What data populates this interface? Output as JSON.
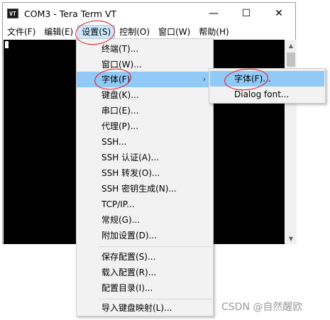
{
  "window": {
    "title": "COM3 - Tera Term VT",
    "icon_text": "VT",
    "controls": {
      "minimize": "—",
      "maximize": "☐",
      "close": "✕"
    }
  },
  "menubar": {
    "items": [
      {
        "label": "文件(F)"
      },
      {
        "label": "编辑(E)"
      },
      {
        "label": "设置(S)",
        "active": true
      },
      {
        "label": "控制(O)"
      },
      {
        "label": "窗口(W)"
      },
      {
        "label": "帮助(H)"
      }
    ]
  },
  "settings_menu": {
    "items": [
      {
        "label": "终端(T)..."
      },
      {
        "label": "窗口(W)..."
      },
      {
        "label": "字体(F)",
        "has_submenu": true,
        "highlighted": true
      },
      {
        "label": "键盘(K)..."
      },
      {
        "label": "串口(E)..."
      },
      {
        "label": "代理(P)..."
      },
      {
        "label": "SSH..."
      },
      {
        "label": "SSH 认证(A)..."
      },
      {
        "label": "SSH 转发(O)..."
      },
      {
        "label": "SSH 密钥生成(N)..."
      },
      {
        "label": "TCP/IP..."
      },
      {
        "label": "常规(G)..."
      },
      {
        "label": "附加设置(D)..."
      },
      {
        "label": "保存配置(S)..."
      },
      {
        "label": "载入配置(R)..."
      },
      {
        "label": "配置目录(I)..."
      },
      {
        "label": "导入键盘映射(L)..."
      }
    ],
    "submenu_arrow": "›"
  },
  "font_submenu": {
    "items": [
      {
        "label": "字体(F)...",
        "highlighted": true
      },
      {
        "label": "Dialog font..."
      }
    ]
  },
  "colors": {
    "highlight": "#91c9f7",
    "menu_active": "#cce8ff",
    "annotation": "#e4141b",
    "terminal_bg": "#000000"
  },
  "watermark": "CSDN @自然醒欧"
}
